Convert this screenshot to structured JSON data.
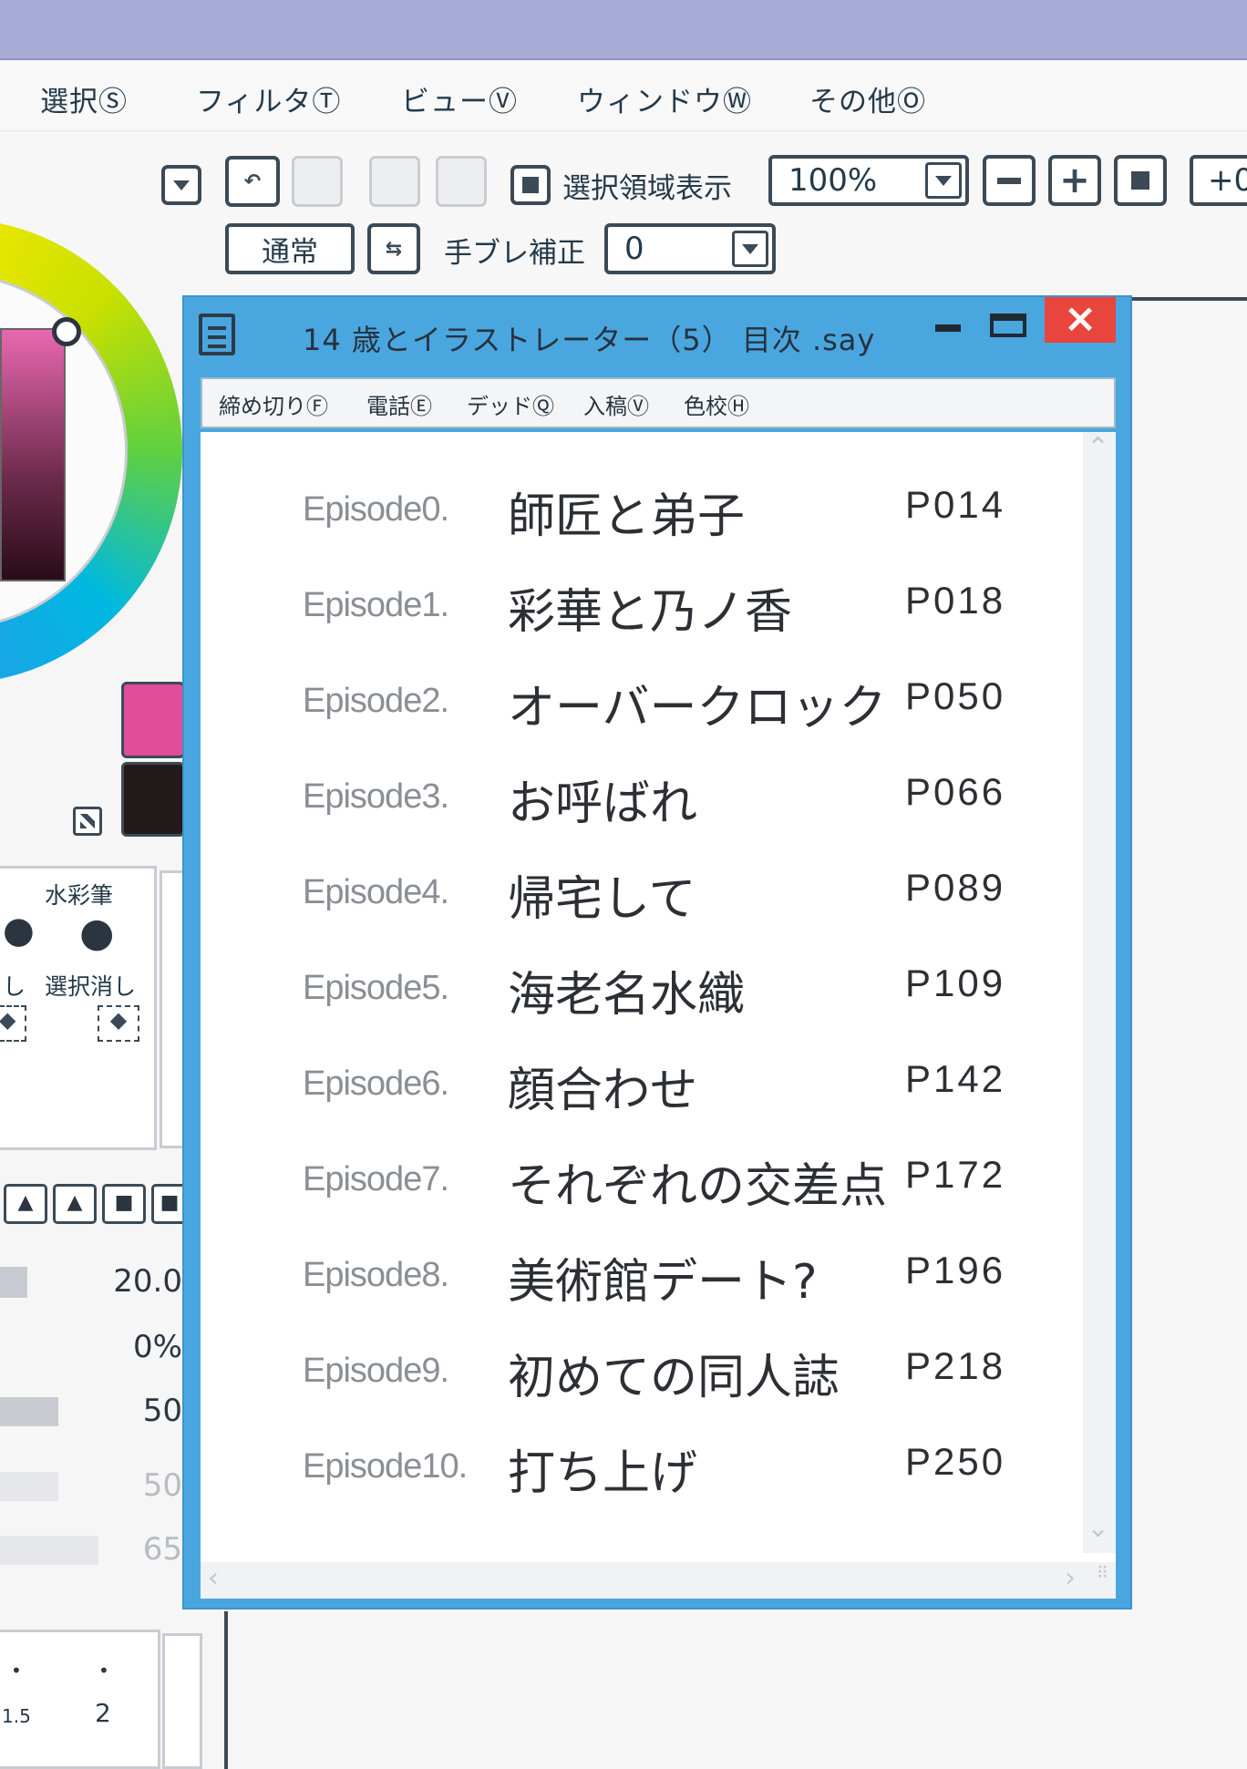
{
  "menu": {
    "items": [
      "選択Ⓢ",
      "フィルタⓉ",
      "ビューⓋ",
      "ウィンドウⓌ",
      "その他Ⓞ"
    ]
  },
  "toolbar": {
    "show_selection_label": "選択領域表示",
    "zoom_value": "100%",
    "rotate_value": "+0",
    "blend_mode": "通常",
    "stabilizer_label": "手ブレ補正",
    "stabilizer_value": "0",
    "minus": "−",
    "plus": "+"
  },
  "left_panel": {
    "brush_watercolor": "水彩筆",
    "brush_deselect": "選択消し",
    "brush_partial": "し",
    "values": [
      "20.0",
      "0%",
      "50",
      "50",
      "65"
    ],
    "size_values": [
      "1.5",
      "2"
    ]
  },
  "dialog": {
    "title": "14 歳とイラストレーター（5） 目次 .say",
    "close_glyph": "×",
    "menu": [
      "締め切りⒻ",
      "電話Ⓔ",
      "デッドⓆ",
      "入稿Ⓥ",
      "色校Ⓗ"
    ],
    "toc": [
      {
        "episode": "Episode0.",
        "title": "師匠と弟子",
        "page": "P014"
      },
      {
        "episode": "Episode1.",
        "title": "彩華と乃ノ香",
        "page": "P018"
      },
      {
        "episode": "Episode2.",
        "title": "オーバークロック",
        "page": "P050"
      },
      {
        "episode": "Episode3.",
        "title": "お呼ばれ",
        "page": "P066"
      },
      {
        "episode": "Episode4.",
        "title": "帰宅して",
        "page": "P089"
      },
      {
        "episode": "Episode5.",
        "title": "海老名水織",
        "page": "P109"
      },
      {
        "episode": "Episode6.",
        "title": "顔合わせ",
        "page": "P142"
      },
      {
        "episode": "Episode7.",
        "title": "それぞれの交差点",
        "page": "P172"
      },
      {
        "episode": "Episode8.",
        "title": "美術館デート?",
        "page": "P196"
      },
      {
        "episode": "Episode9.",
        "title": "初めての同人誌",
        "page": "P218"
      },
      {
        "episode": "Episode10.",
        "title": "打ち上げ",
        "page": "P250"
      }
    ]
  },
  "colors": {
    "dialog_frame": "#4aa6df",
    "close_button": "#e8453c",
    "title_bar": "#a9acd6",
    "primary_color": "#e14d9a",
    "secondary_color": "#231a1a"
  }
}
